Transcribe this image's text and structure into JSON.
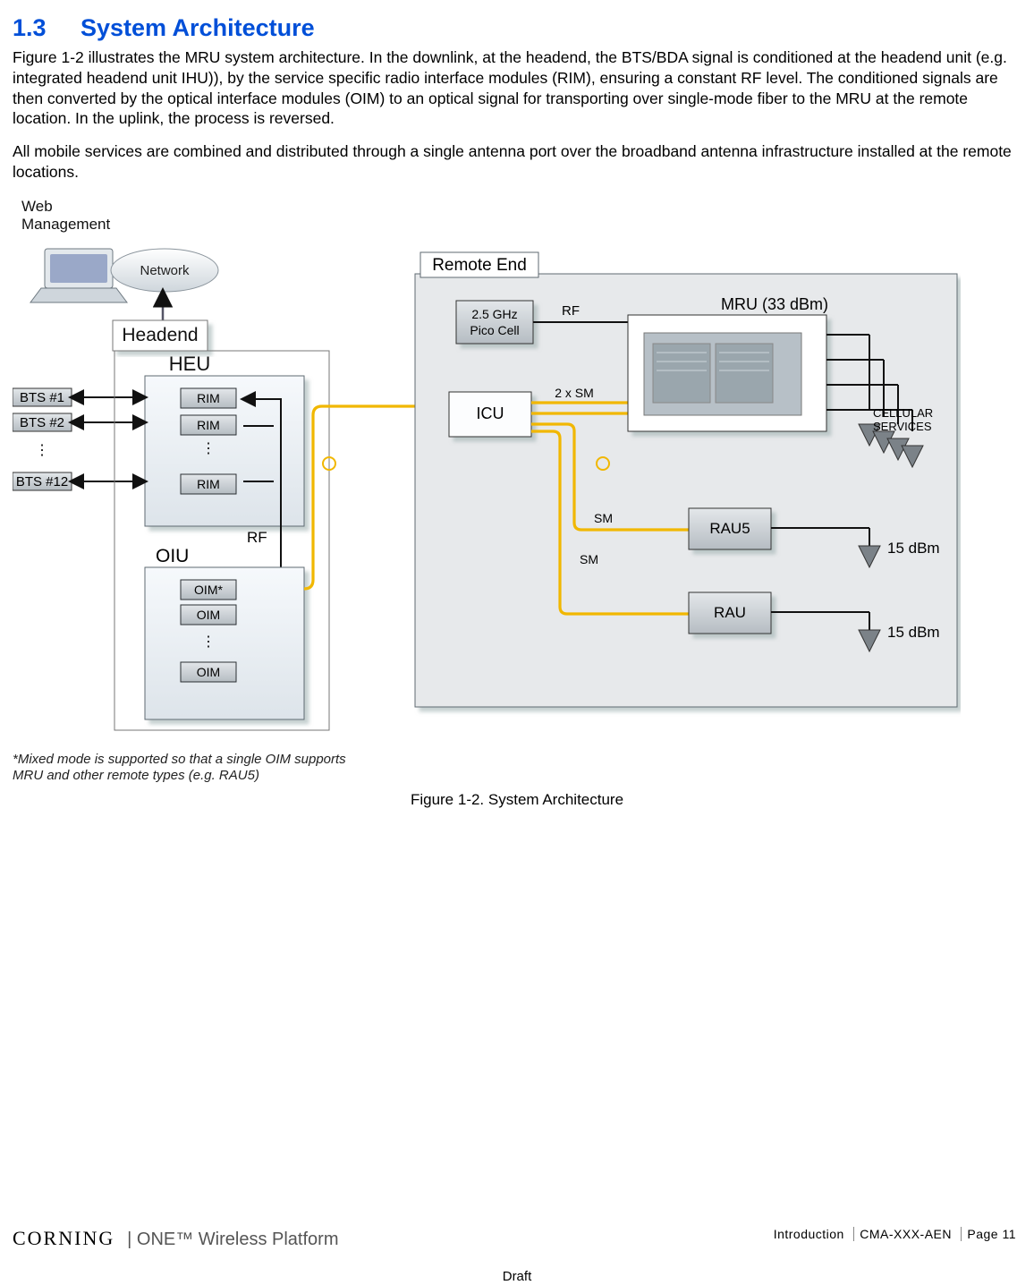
{
  "heading": {
    "number": "1.3",
    "title": "System Architecture"
  },
  "para1": "Figure 1-2 illustrates the MRU system architecture. In the downlink, at the headend, the BTS/BDA signal is conditioned at the headend unit (e.g. integrated headend unit IHU)), by the service specific radio interface modules (RIM), ensuring a constant RF level. The conditioned signals are then converted by the optical interface modules (OIM) to an optical signal for transporting over single-mode fiber to the MRU at the remote location. In the uplink, the process is reversed.",
  "para2": "All mobile services are combined and distributed through a single antenna port over the broadband antenna infrastructure installed at the remote locations.",
  "figure": {
    "caption": "Figure 1-2. System Architecture",
    "footnote1": "*Mixed mode is supported so that a single OIM supports",
    "footnote2": "MRU and other remote types (e.g. RAU5)",
    "labels": {
      "webmgmt1": "Web",
      "webmgmt2": "Management",
      "network": "Network",
      "headend": "Headend",
      "heu": "HEU",
      "rim": "RIM",
      "bts1": "BTS #1",
      "bts2": "BTS #2",
      "bts12": "BTS #12",
      "rf": "RF",
      "oiu": "OIU",
      "oim1": "OIM*",
      "oim": "OIM",
      "remoteEnd": "Remote End",
      "icu": "ICU",
      "pico1": "2.5 GHz",
      "pico2": "Pico Cell",
      "rfLbl": "RF",
      "twosm": "2 x SM",
      "sm": "SM",
      "mru": "MRU (33 dBm)",
      "rau5": "RAU5",
      "rau": "RAU",
      "db15a": "15 dBm",
      "db15b": "15 dBm",
      "cell1": "CELLULAR",
      "cell2": "SERVICES"
    }
  },
  "footer": {
    "brand": "CORNING",
    "brand2": "ONE™ Wireless Platform",
    "section": "Introduction",
    "doc": "CMA-XXX-AEN",
    "page": "Page 11",
    "draft": "Draft"
  }
}
